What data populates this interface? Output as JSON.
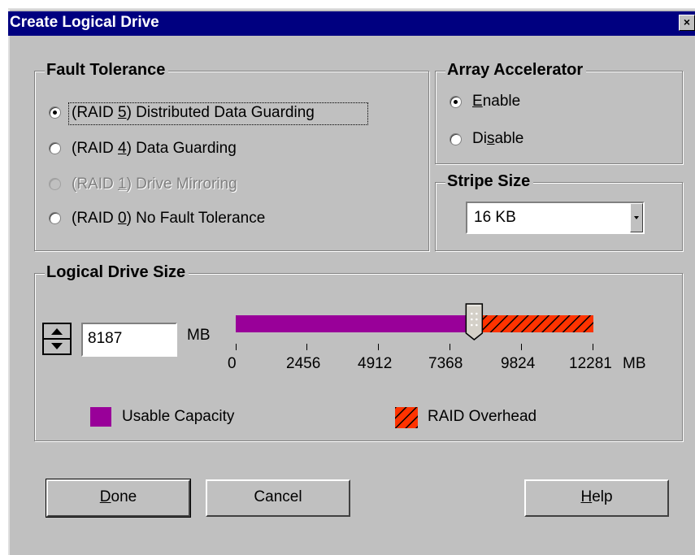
{
  "window": {
    "title": "Create Logical Drive",
    "close_glyph": "×"
  },
  "fault_tolerance": {
    "legend": "Fault Tolerance",
    "options": [
      {
        "pre": "(RAID ",
        "key": "5",
        "post": ") Distributed Data Guarding",
        "state": "checked"
      },
      {
        "pre": "(RAID ",
        "key": "4",
        "post": ") Data Guarding",
        "state": "unchecked"
      },
      {
        "pre": "(RAID ",
        "key": "1",
        "post": ") Drive Mirroring",
        "state": "disabled"
      },
      {
        "pre": "(RAID ",
        "key": "0",
        "post": ") No Fault Tolerance",
        "state": "unchecked"
      }
    ]
  },
  "array_accelerator": {
    "legend": "Array Accelerator",
    "enable": {
      "key": "E",
      "rest": "nable",
      "checked": true
    },
    "disable": {
      "pre": "Di",
      "key": "s",
      "rest": "able",
      "checked": false
    }
  },
  "stripe_size": {
    "legend": "Stripe Size",
    "value": "16 KB"
  },
  "logical_drive_size": {
    "legend": "Logical Drive Size",
    "value": "8187",
    "unit": "MB",
    "max_mb": 12281,
    "usable_mb": 8187,
    "axis_labels": [
      "0",
      "2456",
      "4912",
      "7368",
      "9824",
      "12281"
    ],
    "axis_unit": "MB",
    "legend_usable": "Usable Capacity",
    "legend_overhead": "RAID Overhead",
    "colors": {
      "usable": "#990099",
      "overhead": "#ff3300"
    }
  },
  "buttons": {
    "done": {
      "key": "D",
      "rest": "one"
    },
    "cancel": {
      "label": "Cancel"
    },
    "help": {
      "key": "H",
      "rest": "elp"
    }
  }
}
